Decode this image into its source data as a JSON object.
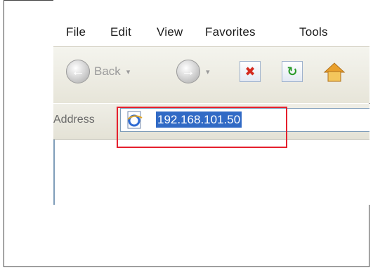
{
  "menu": {
    "items": [
      "File",
      "Edit",
      "View",
      "Favorites",
      "Tools"
    ]
  },
  "toolbar": {
    "back_label": "Back",
    "back_arrow": "←",
    "forward_arrow": "→",
    "dropdown_glyph": "▾",
    "stop_glyph": "✖",
    "refresh_glyph": "↻"
  },
  "address": {
    "label": "Address",
    "value": "192.168.101.50"
  },
  "colors": {
    "highlight_border": "#e5202d",
    "selection": "#316ac5",
    "stop_icon": "#d42a1f",
    "refresh_icon": "#2a9a2a"
  },
  "icons": {
    "back": "back-arrow-icon",
    "forward": "forward-arrow-icon",
    "stop": "stop-icon",
    "refresh": "refresh-icon",
    "home": "home-icon",
    "page": "ie-page-icon"
  }
}
